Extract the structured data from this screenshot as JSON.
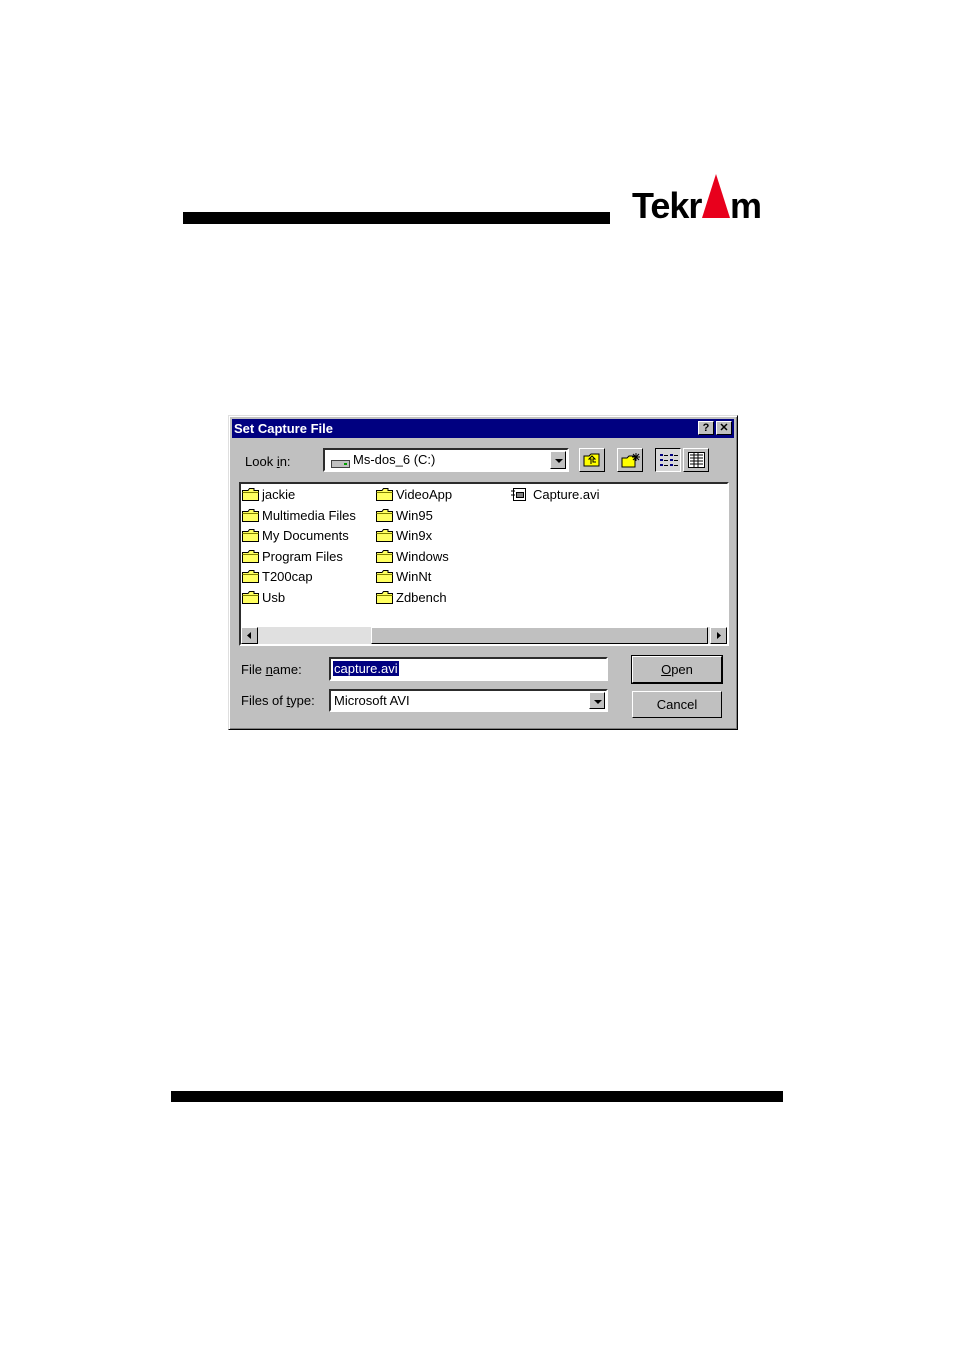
{
  "brand": {
    "logo_text": "Tekram"
  },
  "dialog": {
    "title": "Set Capture File",
    "help_button": "?",
    "close_button": "✕",
    "look_in_label_pre": "Look ",
    "look_in_label_key": "i",
    "look_in_label_post": "n:",
    "look_in_value": "Ms-dos_6 (C:)",
    "file_list": {
      "column1": [
        "jackie",
        "Multimedia Files",
        "My Documents",
        "Program Files",
        "T200cap",
        "Usb"
      ],
      "column2": [
        "VideoApp",
        "Win95",
        "Win9x",
        "Windows",
        "WinNt",
        "Zdbench"
      ],
      "column3": [
        "Capture.avi"
      ]
    },
    "file_name_label_pre": "File ",
    "file_name_label_key": "n",
    "file_name_label_post": "ame:",
    "file_name_value": "capture.avi",
    "file_type_label_pre": "Files of ",
    "file_type_label_key": "t",
    "file_type_label_post": "ype:",
    "file_type_value": "Microsoft AVI",
    "open_key": "O",
    "open_rest": "pen",
    "cancel_label": "Cancel"
  },
  "icons": {
    "drive": "hard-drive-icon",
    "up": "up-folder-icon",
    "new": "new-folder-icon",
    "list": "list-view-icon",
    "details": "details-view-icon",
    "folder": "folder-icon",
    "avi": "video-file-icon"
  },
  "colors": {
    "titlebar": "#000080",
    "face": "#c0c0c0",
    "logo_red": "#e8001c"
  }
}
